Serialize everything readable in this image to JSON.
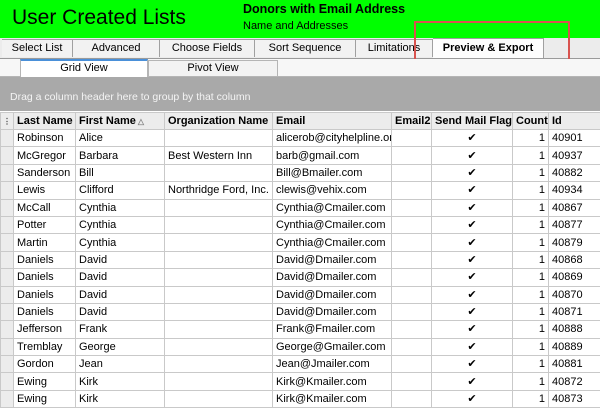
{
  "header": {
    "app_title": "User Created Lists",
    "list_title": "Donors with Email Address",
    "list_subtitle": "Name and Addresses"
  },
  "main_tabs": [
    {
      "label": "Select List",
      "active": false
    },
    {
      "label": "Advanced",
      "active": false
    },
    {
      "label": "Choose Fields",
      "active": false
    },
    {
      "label": "Sort Sequence",
      "active": false
    },
    {
      "label": "Limitations",
      "active": false
    },
    {
      "label": "Preview & Export",
      "active": true
    }
  ],
  "view_tabs": [
    {
      "label": "Grid View",
      "active": true
    },
    {
      "label": "Pivot View",
      "active": false
    }
  ],
  "group_panel": {
    "hint": "Drag a column header here to group by that column"
  },
  "grid": {
    "columns": [
      "Last Name",
      "First Name",
      "Organization Name",
      "Email",
      "Email2",
      "Send Mail Flag",
      "Count",
      "Id"
    ],
    "rows": [
      [
        "Robinson",
        "Alice",
        "",
        "alicerob@cityhelpline.org",
        "",
        true,
        "1",
        "40901"
      ],
      [
        "McGregor",
        "Barbara",
        "Best Western Inn",
        "barb@gmail.com",
        "",
        true,
        "1",
        "40937"
      ],
      [
        "Sanderson",
        "Bill",
        "",
        "Bill@Bmailer.com",
        "",
        true,
        "1",
        "40882"
      ],
      [
        "Lewis",
        "Clifford",
        "Northridge Ford, Inc.",
        "clewis@vehix.com",
        "",
        true,
        "1",
        "40934"
      ],
      [
        "McCall",
        "Cynthia",
        "",
        "Cynthia@Cmailer.com",
        "",
        true,
        "1",
        "40867"
      ],
      [
        "Potter",
        "Cynthia",
        "",
        "Cynthia@Cmailer.com",
        "",
        true,
        "1",
        "40877"
      ],
      [
        "Martin",
        "Cynthia",
        "",
        "Cynthia@Cmailer.com",
        "",
        true,
        "1",
        "40879"
      ],
      [
        "Daniels",
        "David",
        "",
        "David@Dmailer.com",
        "",
        true,
        "1",
        "40868"
      ],
      [
        "Daniels",
        "David",
        "",
        "David@Dmailer.com",
        "",
        true,
        "1",
        "40869"
      ],
      [
        "Daniels",
        "David",
        "",
        "David@Dmailer.com",
        "",
        true,
        "1",
        "40870"
      ],
      [
        "Daniels",
        "David",
        "",
        "David@Dmailer.com",
        "",
        true,
        "1",
        "40871"
      ],
      [
        "Jefferson",
        "Frank",
        "",
        "Frank@Fmailer.com",
        "",
        true,
        "1",
        "40888"
      ],
      [
        "Tremblay",
        "George",
        "",
        "George@Gmailer.com",
        "",
        true,
        "1",
        "40889"
      ],
      [
        "Gordon",
        "Jean",
        "",
        "Jean@Jmailer.com",
        "",
        true,
        "1",
        "40881"
      ],
      [
        "Ewing",
        "Kirk",
        "",
        "Kirk@Kmailer.com",
        "",
        true,
        "1",
        "40872"
      ],
      [
        "Ewing",
        "Kirk",
        "",
        "Kirk@Kmailer.com",
        "",
        true,
        "1",
        "40873"
      ]
    ]
  },
  "colors": {
    "header_green": "#00ff00",
    "highlight_red": "#d9534f",
    "active_view_tab": "#4a90d9"
  },
  "icons": {
    "row_indicator": "column-chooser-icon",
    "sort": "sort-ascending-icon",
    "check": "checkbox-checked-icon"
  }
}
